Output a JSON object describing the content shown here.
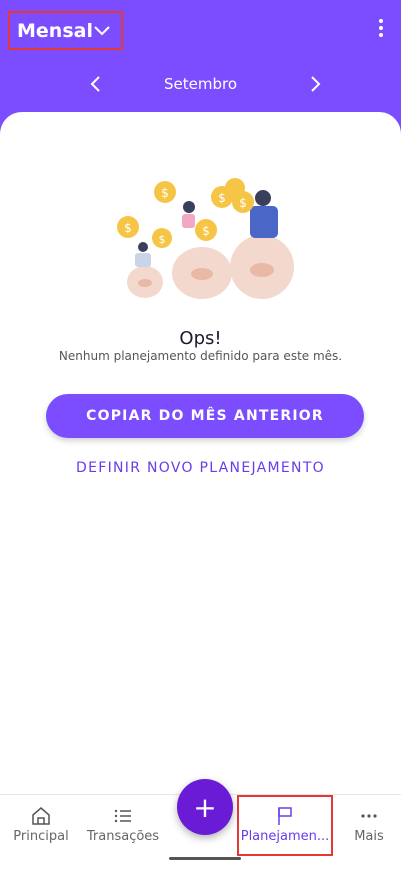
{
  "header": {
    "period": "Mensal",
    "month": "Setembro"
  },
  "empty_state": {
    "title": "Ops!",
    "message": "Nenhum planejamento definido para este mês."
  },
  "actions": {
    "copy_label": "COPIAR DO MÊS ANTERIOR",
    "new_label": "DEFINIR NOVO PLANEJAMENTO"
  },
  "bottom_nav": {
    "items": [
      {
        "label": "Principal",
        "icon": "home-icon"
      },
      {
        "label": "Transações",
        "icon": "list-icon"
      },
      {
        "label": "Planejamen...",
        "icon": "flag-icon"
      },
      {
        "label": "Mais",
        "icon": "more-horizontal-icon"
      }
    ],
    "fab_label": "+"
  },
  "colors": {
    "primary": "#7c4dff",
    "fab": "#6a1bd6",
    "highlight_box": "#e53935"
  }
}
